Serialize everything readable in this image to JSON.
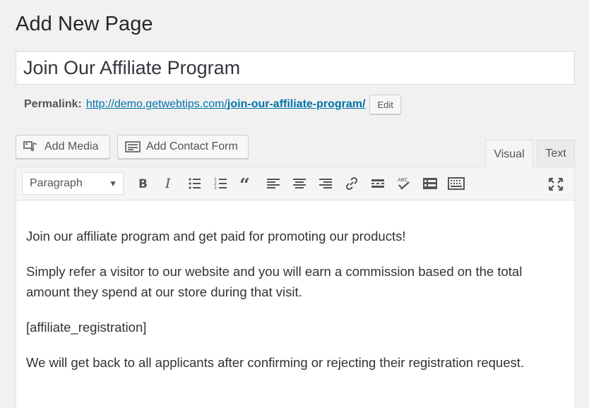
{
  "page": {
    "title": "Add New Page"
  },
  "post_title": {
    "value": "Join Our Affiliate Program"
  },
  "permalink": {
    "label": "Permalink:",
    "base": "http://demo.getwebtips.com/",
    "slug": "join-our-affiliate-program/",
    "edit_label": "Edit"
  },
  "media_buttons": {
    "add_media": "Add Media",
    "add_contact_form": "Add Contact Form"
  },
  "editor_tabs": {
    "visual": "Visual",
    "text": "Text",
    "active": "visual"
  },
  "toolbar": {
    "format_value": "Paragraph",
    "buttons": [
      "bold-icon",
      "italic-icon",
      "bullet-list-icon",
      "numbered-list-icon",
      "blockquote-icon",
      "align-left-icon",
      "align-center-icon",
      "align-right-icon",
      "link-icon",
      "read-more-icon",
      "spellcheck-icon",
      "form-icon",
      "keyboard-icon",
      "fullscreen-icon"
    ],
    "spellcheck_glyph": "ABC"
  },
  "content": {
    "paragraphs": [
      "Join our affiliate program and get paid for promoting our products!",
      "Simply refer a visitor to our website and you will earn a commission based on the total amount they spend at our store during that visit.",
      "[affiliate_registration]",
      "We will get back to all applicants after confirming or rejecting their registration request."
    ]
  }
}
